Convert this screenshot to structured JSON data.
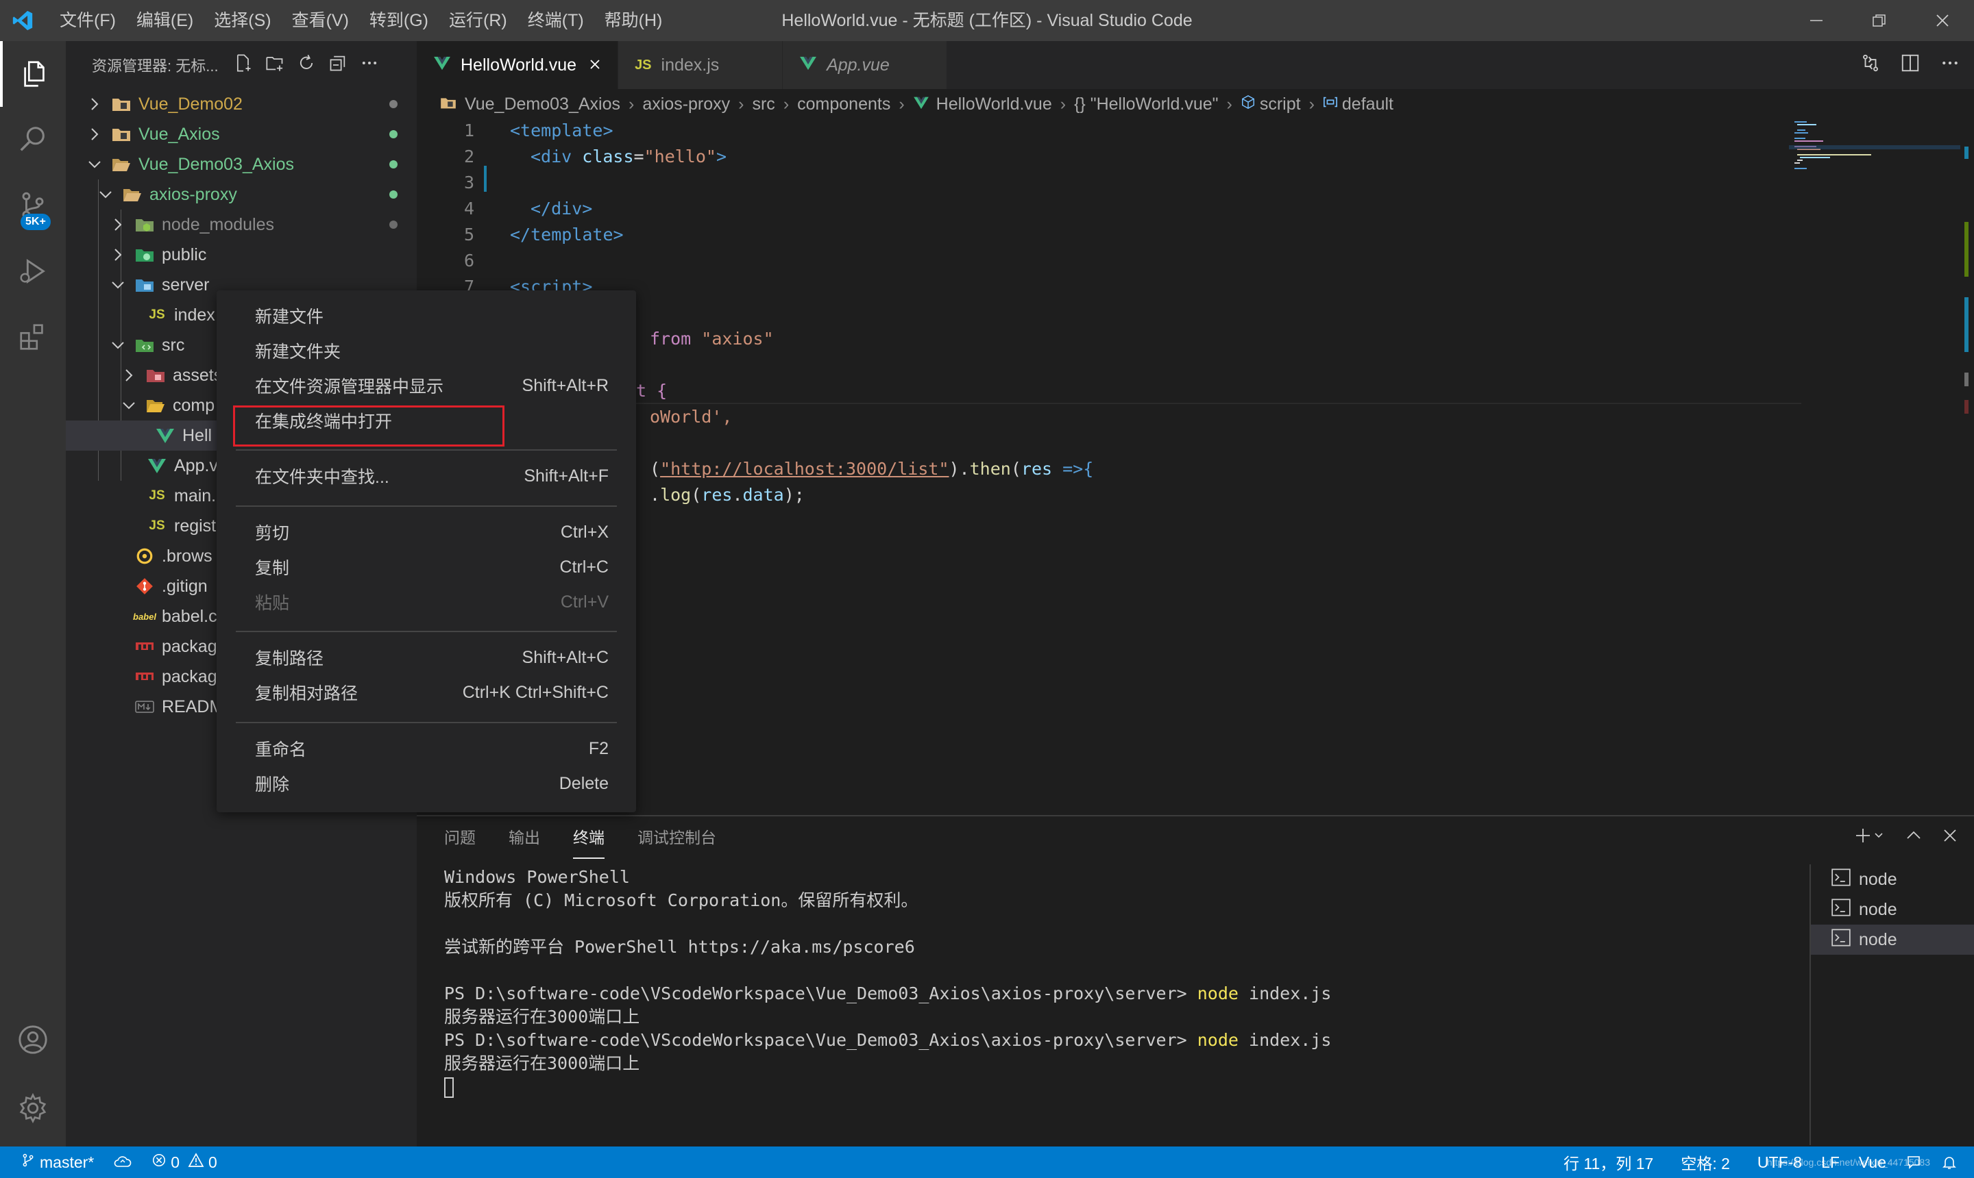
{
  "titlebar": {
    "menus": [
      "文件(F)",
      "编辑(E)",
      "选择(S)",
      "查看(V)",
      "转到(G)",
      "运行(R)",
      "终端(T)",
      "帮助(H)"
    ],
    "window_title": "HelloWorld.vue - 无标题 (工作区) - Visual Studio Code"
  },
  "activity": {
    "scm_badge": "5K+"
  },
  "sidebar": {
    "title": "资源管理器: 无标...",
    "tree": [
      {
        "label": "Vue_Demo02",
        "icon": "folder-icon"
      },
      {
        "label": "Vue_Axios",
        "icon": "folder-icon"
      },
      {
        "label": "Vue_Demo03_Axios",
        "icon": "folder-open-icon"
      },
      {
        "label": "axios-proxy",
        "icon": "folder-open-icon"
      },
      {
        "label": "node_modules",
        "icon": "node-modules-folder-icon"
      },
      {
        "label": "public",
        "icon": "public-folder-icon"
      },
      {
        "label": "server",
        "icon": "server-folder-icon"
      },
      {
        "label": "index",
        "icon": "js-file-icon"
      },
      {
        "label": "src",
        "icon": "src-folder-icon"
      },
      {
        "label": "assets",
        "icon": "assets-folder-icon"
      },
      {
        "label": "comp",
        "icon": "components-folder-icon"
      },
      {
        "label": "Hell",
        "icon": "vue-file-icon"
      },
      {
        "label": "App.v",
        "icon": "vue-file-icon"
      },
      {
        "label": "main.",
        "icon": "js-file-icon"
      },
      {
        "label": "regist",
        "icon": "js-file-icon"
      },
      {
        "label": ".brows",
        "icon": "browserslist-file-icon"
      },
      {
        "label": ".gitign",
        "icon": "git-file-icon"
      },
      {
        "label": "babel.c",
        "icon": "babel-file-icon"
      },
      {
        "label": "packag",
        "icon": "npm-file-icon"
      },
      {
        "label": "packag",
        "icon": "npm-file-icon"
      },
      {
        "label": "READM",
        "icon": "markdown-file-icon"
      }
    ]
  },
  "tabs": [
    {
      "label": "HelloWorld.vue",
      "icon": "vue-icon",
      "active": true
    },
    {
      "label": "index.js",
      "icon": "js-icon",
      "active": false
    },
    {
      "label": "App.vue",
      "icon": "vue-icon",
      "active": false
    }
  ],
  "breadcrumb": {
    "items": [
      "Vue_Demo03_Axios",
      "axios-proxy",
      "src",
      "components",
      "HelloWorld.vue",
      "{} \"HelloWorld.vue\"",
      "script",
      "default"
    ]
  },
  "editor": {
    "line_numbers": [
      "1",
      "2",
      "3",
      "4",
      "5",
      "6",
      "7"
    ],
    "lines": {
      "l1": "<template>",
      "l2a": "<div ",
      "l2b": "class",
      "l2c": "=",
      "l2d": "\"hello\"",
      "l2e": ">",
      "l4": "</div>",
      "l5": "</template>",
      "l7": "<script>",
      "l9a": "from ",
      "l9b": "\"axios\"",
      "l11a": "t {",
      "l12a": "oWorld',",
      "l14a": "(",
      "l14b": "\"http://localhost:3000/list\"",
      "l14c": ").",
      "l14d": "then",
      "l14e": "(",
      "l14f": "res",
      "l14g": " =>{",
      "l15a": ".",
      "l15b": "log",
      "l15c": "(",
      "l15d": "res",
      "l15e": ".",
      "l15f": "data",
      "l15g": ");"
    }
  },
  "context_menu": {
    "items": [
      {
        "label": "新建文件",
        "shortcut": ""
      },
      {
        "label": "新建文件夹",
        "shortcut": ""
      },
      {
        "label": "在文件资源管理器中显示",
        "shortcut": "Shift+Alt+R"
      },
      {
        "label": "在集成终端中打开",
        "shortcut": ""
      },
      {
        "label": "在文件夹中查找...",
        "shortcut": "Shift+Alt+F"
      },
      {
        "label": "剪切",
        "shortcut": "Ctrl+X"
      },
      {
        "label": "复制",
        "shortcut": "Ctrl+C"
      },
      {
        "label": "粘贴",
        "shortcut": "Ctrl+V"
      },
      {
        "label": "复制路径",
        "shortcut": "Shift+Alt+C"
      },
      {
        "label": "复制相对路径",
        "shortcut": "Ctrl+K Ctrl+Shift+C"
      },
      {
        "label": "重命名",
        "shortcut": "F2"
      },
      {
        "label": "删除",
        "shortcut": "Delete"
      }
    ]
  },
  "panel": {
    "tabs": [
      "问题",
      "输出",
      "终端",
      "调试控制台"
    ],
    "terminal_lines": {
      "t1": "Windows PowerShell",
      "t2": "版权所有 (C) Microsoft Corporation。保留所有权利。",
      "t3": "尝试新的跨平台 PowerShell https://aka.ms/pscore6",
      "t4p": "PS D:\\software-code\\VScodeWorkspace\\Vue_Demo03_Axios\\axios-proxy\\server> ",
      "t4c": "node",
      "t4a": " index.js",
      "t5": "服务器运行在3000端口上",
      "t6p": "PS D:\\software-code\\VScodeWorkspace\\Vue_Demo03_Axios\\axios-proxy\\server> ",
      "t6c": "node",
      "t6a": " index.js",
      "t7": "服务器运行在3000端口上"
    },
    "terminals": [
      "node",
      "node",
      "node"
    ]
  },
  "status": {
    "branch": "master*",
    "errors": "0",
    "warnings": "0",
    "position": "行 11，列 17",
    "spaces": "空格: 2",
    "encoding": "UTF-8",
    "eol": "LF",
    "language": "Vue",
    "watermark": "https://blog.csdn.net/weixin_44715083"
  },
  "colors": {
    "accent": "#007acc",
    "highlight_box": "#e0202a",
    "vue_green": "#41b883",
    "js_yellow": "#cbcb41"
  }
}
